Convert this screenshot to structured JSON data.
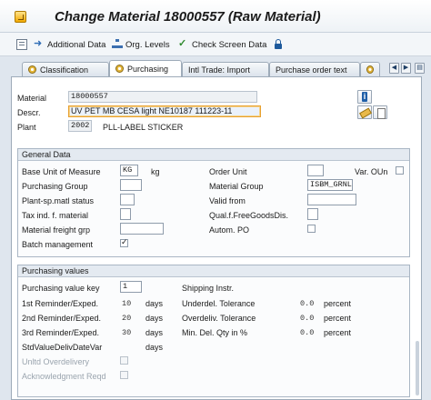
{
  "window": {
    "title": "Change Material 18000557 (Raw Material)"
  },
  "toolbar": {
    "additional_data": "Additional Data",
    "org_levels": "Org. Levels",
    "check_screen_data": "Check Screen Data"
  },
  "tabs": [
    {
      "label": "Classification"
    },
    {
      "label": "Purchasing"
    },
    {
      "label": "Intl Trade: Import"
    },
    {
      "label": "Purchase order text"
    }
  ],
  "header": {
    "material_label": "Material",
    "material_value": "18000557",
    "descr_label": "Descr.",
    "descr_value": "UV PET MB CESA light NE10187 111223-11",
    "plant_label": "Plant",
    "plant_value": "2002",
    "plant_name": "PLL-LABEL STICKER"
  },
  "general": {
    "title": "General Data",
    "base_uom_label": "Base Unit of Measure",
    "base_uom_value": "KG",
    "base_uom_unit": "kg",
    "order_unit_label": "Order Unit",
    "var_oun_label": "Var. OUn",
    "purchasing_group_label": "Purchasing Group",
    "material_group_label": "Material Group",
    "material_group_value": "ISBM_GRNL",
    "plant_sp_status_label": "Plant-sp.matl status",
    "valid_from_label": "Valid from",
    "tax_ind_label": "Tax ind. f. material",
    "qual_free_goods_label": "Qual.f.FreeGoodsDis.",
    "mat_freight_grp_label": "Material freight grp",
    "autom_po_label": "Autom. PO",
    "batch_mgmt_label": "Batch management",
    "batch_mgmt_checked": true
  },
  "purchasing": {
    "title": "Purchasing values",
    "pv_key_label": "Purchasing value key",
    "pv_key_value": "1",
    "shipping_instr_label": "Shipping Instr.",
    "rem1_label": "1st Reminder/Exped.",
    "rem1_value": "10",
    "rem1_unit": "days",
    "underdel_label": "Underdel. Tolerance",
    "underdel_value": "0.0",
    "underdel_unit": "percent",
    "rem2_label": "2nd Reminder/Exped.",
    "rem2_value": "20",
    "rem2_unit": "days",
    "overdel_label": "Overdeliv. Tolerance",
    "overdel_value": "0.0",
    "overdel_unit": "percent",
    "rem3_label": "3rd Reminder/Exped.",
    "rem3_value": "30",
    "rem3_unit": "days",
    "min_del_label": "Min. Del. Qty in %",
    "min_del_value": "0.0",
    "min_del_unit": "percent",
    "std_value_label": "StdValueDelivDateVar",
    "std_value_unit": "days",
    "unltd_over_label": "Unltd Overdelivery",
    "ack_reqd_label": "Acknowledgment Reqd"
  }
}
